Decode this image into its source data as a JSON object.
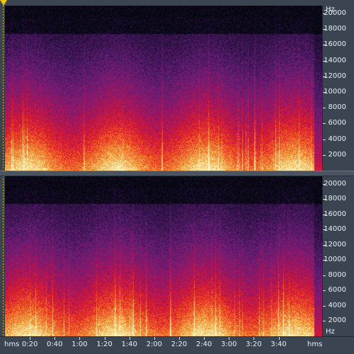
{
  "frequency_axis": {
    "unit_label": "Hz",
    "ticks": [
      "20000",
      "18000",
      "16000",
      "14000",
      "12000",
      "10000",
      "8000",
      "6000",
      "4000",
      "2000"
    ],
    "tick_values": [
      20000,
      18000,
      16000,
      14000,
      12000,
      10000,
      8000,
      6000,
      4000,
      2000
    ],
    "max_hz": 21000
  },
  "time_axis": {
    "left_label": "hms",
    "right_label": "hms",
    "ticks": [
      "0:20",
      "0:40",
      "1:00",
      "1:20",
      "1:40",
      "2:00",
      "2:20",
      "2:40",
      "3:00",
      "3:20",
      "3:40"
    ],
    "tick_seconds": [
      20,
      40,
      60,
      80,
      100,
      120,
      140,
      160,
      180,
      200,
      220
    ],
    "total_seconds": 255
  },
  "channels": [
    "left",
    "right"
  ],
  "colors": {
    "background": "#05070f",
    "panel": "#3b4552",
    "playhead": "#f2c400"
  }
}
